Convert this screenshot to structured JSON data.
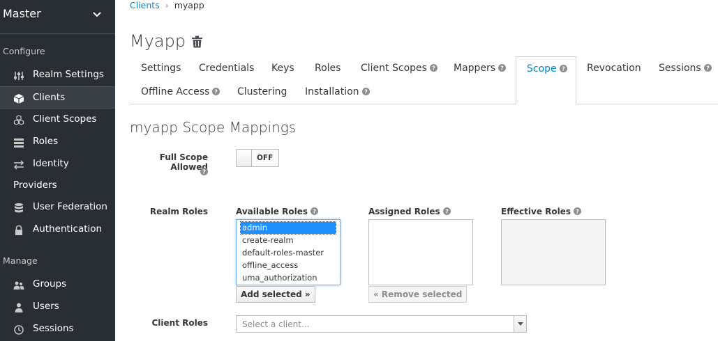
{
  "sidebar": {
    "realm": "Master",
    "configure_label": "Configure",
    "manage_label": "Manage",
    "configure_items": [
      {
        "label": "Realm Settings",
        "icon": "sliders-icon"
      },
      {
        "label": "Clients",
        "icon": "cube-icon",
        "active": true
      },
      {
        "label": "Client Scopes",
        "icon": "cubes-icon"
      },
      {
        "label": "Roles",
        "icon": "list-icon"
      },
      {
        "label": "Identity",
        "label2": "Providers",
        "icon": "exchange-icon"
      },
      {
        "label": "User Federation",
        "icon": "database-icon"
      },
      {
        "label": "Authentication",
        "icon": "lock-icon"
      }
    ],
    "manage_items": [
      {
        "label": "Groups",
        "icon": "users-icon"
      },
      {
        "label": "Users",
        "icon": "user-icon"
      },
      {
        "label": "Sessions",
        "icon": "clock-icon"
      }
    ]
  },
  "breadcrumb": {
    "parent": "Clients",
    "separator": "›",
    "current": "myapp"
  },
  "page": {
    "title": "Myapp"
  },
  "tabs": [
    {
      "label": "Settings"
    },
    {
      "label": "Credentials"
    },
    {
      "label": "Keys"
    },
    {
      "label": "Roles"
    },
    {
      "label": "Client Scopes",
      "help": true
    },
    {
      "label": "Mappers",
      "help": true
    },
    {
      "label": "Scope",
      "help": true,
      "active": true
    },
    {
      "label": "Revocation"
    },
    {
      "label": "Sessions",
      "help": true
    },
    {
      "label": "Offline Access",
      "help": true
    },
    {
      "label": "Clustering"
    },
    {
      "label": "Installation",
      "help": true
    }
  ],
  "scope": {
    "title": "myapp Scope Mappings",
    "full_scope_label": "Full Scope Allowed",
    "toggle_state": "OFF",
    "realm_roles_label": "Realm Roles",
    "available_label": "Available Roles",
    "assigned_label": "Assigned Roles",
    "effective_label": "Effective Roles",
    "available_roles": [
      "admin",
      "create-realm",
      "default-roles-master",
      "offline_access",
      "uma_authorization"
    ],
    "selected_role": "admin",
    "add_button": "Add selected »",
    "remove_button": "« Remove selected",
    "client_roles_label": "Client Roles",
    "client_placeholder": "Select a client..."
  },
  "colors": {
    "sidebar_bg": "#292e34",
    "accent": "#0088ce",
    "selected": "#1e90ff"
  }
}
